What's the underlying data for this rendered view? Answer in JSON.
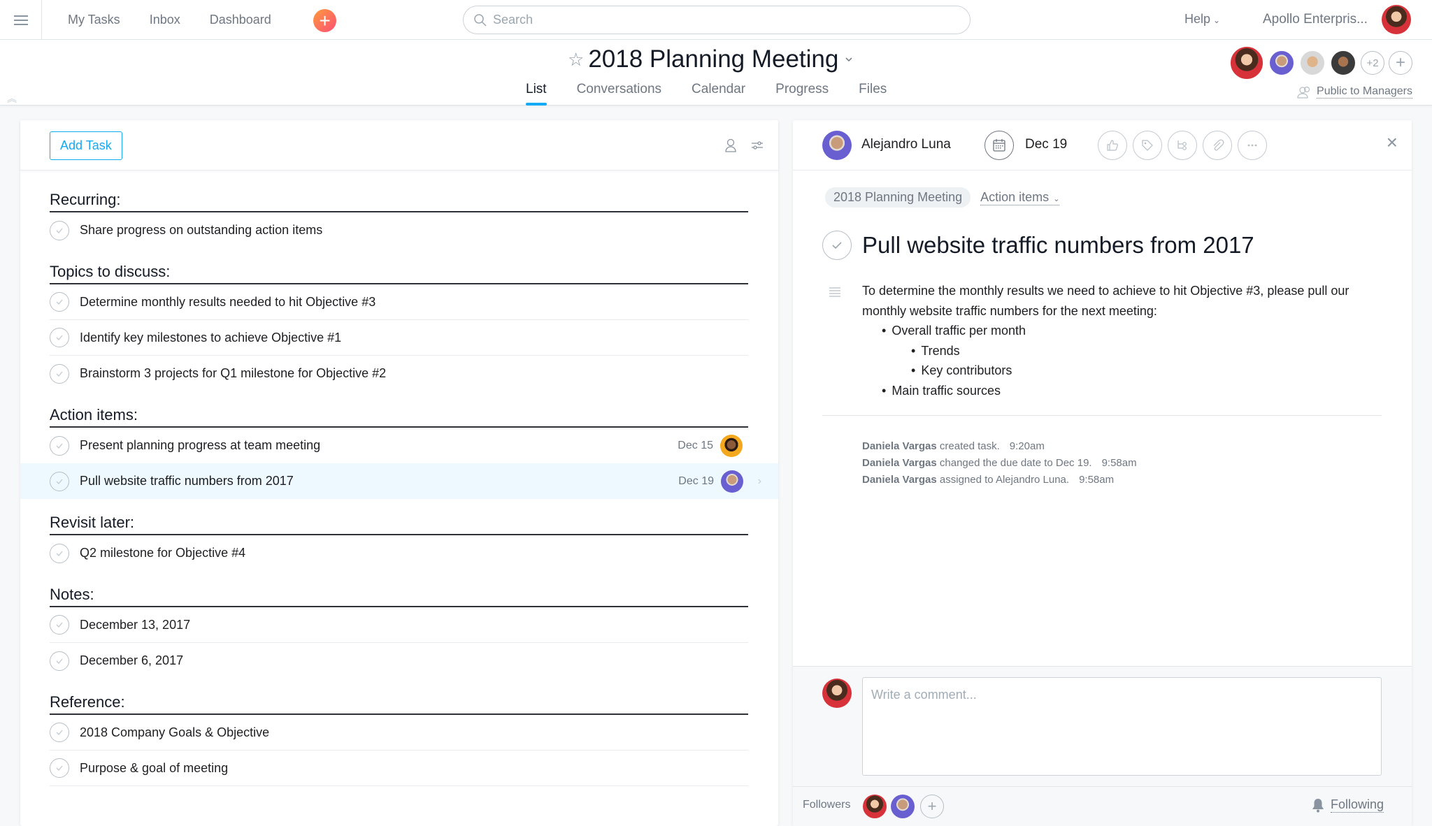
{
  "topbar": {
    "nav": [
      "My Tasks",
      "Inbox",
      "Dashboard"
    ],
    "search_placeholder": "Search",
    "help": "Help",
    "org": "Apollo Enterpris..."
  },
  "project": {
    "title": "2018 Planning Meeting",
    "tabs": [
      {
        "label": "List",
        "active": true
      },
      {
        "label": "Conversations",
        "active": false
      },
      {
        "label": "Calendar",
        "active": false
      },
      {
        "label": "Progress",
        "active": false
      },
      {
        "label": "Files",
        "active": false
      }
    ],
    "members_extra": "+2",
    "privacy": "Public to Managers"
  },
  "list": {
    "add_task_label": "Add Task",
    "sections": [
      {
        "title": "Recurring:",
        "tasks": [
          {
            "name": "Share progress on outstanding action items"
          }
        ]
      },
      {
        "title": "Topics to discuss:",
        "tasks": [
          {
            "name": "Determine monthly results needed to hit Objective #3"
          },
          {
            "name": "Identify key milestones to achieve Objective #1"
          },
          {
            "name": "Brainstorm 3 projects for Q1 milestone for Objective #2"
          }
        ]
      },
      {
        "title": "Action items:",
        "tasks": [
          {
            "name": "Present planning progress at team meeting",
            "due": "Dec 15"
          },
          {
            "name": "Pull website traffic numbers from 2017",
            "due": "Dec 19",
            "selected": true
          }
        ]
      },
      {
        "title": "Revisit later:",
        "tasks": [
          {
            "name": "Q2 milestone for Objective #4"
          }
        ]
      },
      {
        "title": "Notes:",
        "tasks": [
          {
            "name": "December 13, 2017"
          },
          {
            "name": "December 6, 2017"
          }
        ]
      },
      {
        "title": "Reference:",
        "tasks": [
          {
            "name": "2018 Company Goals & Objective"
          },
          {
            "name": "Purpose & goal of meeting"
          }
        ]
      }
    ]
  },
  "detail": {
    "assignee": "Alejandro Luna",
    "due": "Dec 19",
    "project_pill": "2018 Planning Meeting",
    "section": "Action items",
    "title": "Pull website traffic numbers from 2017",
    "description": {
      "intro": "To determine the monthly results we need to achieve to hit Objective #3, please pull our monthly website traffic numbers for the next meeting:",
      "bullets": [
        {
          "level": 1,
          "text": "Overall traffic per month"
        },
        {
          "level": 2,
          "text": "Trends"
        },
        {
          "level": 2,
          "text": "Key contributors"
        },
        {
          "level": 1,
          "text": "Main traffic sources"
        }
      ]
    },
    "stories": [
      {
        "actor": "Daniela Vargas",
        "text": "created task.",
        "time": "9:20am"
      },
      {
        "actor": "Daniela Vargas",
        "text": "changed the due date to Dec 19.",
        "time": "9:58am"
      },
      {
        "actor": "Daniela Vargas",
        "text": "assigned to Alejandro Luna.",
        "time": "9:58am"
      }
    ],
    "comment_placeholder": "Write a comment...",
    "followers_label": "Followers",
    "following_label": "Following"
  },
  "colors": {
    "accent": "#14aaf5",
    "selected_row": "#edf8ff",
    "plus_gradient_start": "#ff9a3c",
    "plus_gradient_end": "#fc4f76"
  }
}
